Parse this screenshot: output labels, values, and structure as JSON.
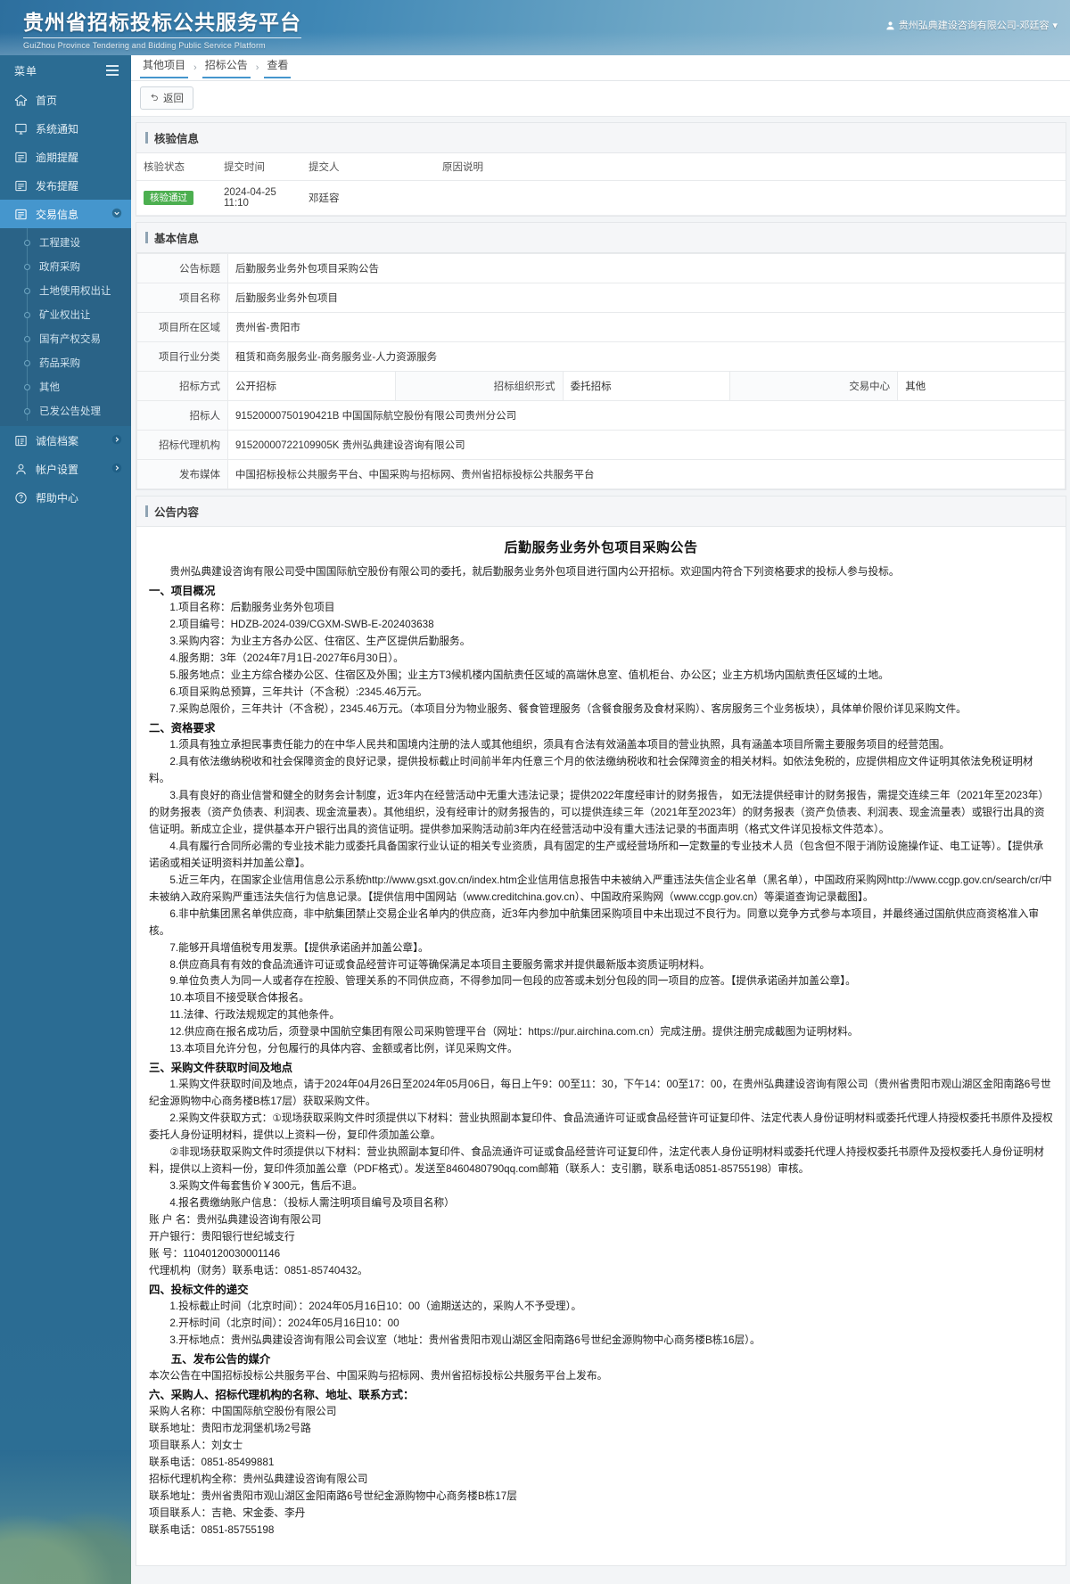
{
  "header": {
    "title": "贵州省招标投标公共服务平台",
    "subtitle": "GuiZhou Province Tendering and Bidding Public Service Platform",
    "user": "贵州弘典建设咨询有限公司-邓廷容",
    "user_caret": "▾"
  },
  "sidebar": {
    "menu_label": "菜单",
    "items": [
      {
        "label": "首页",
        "icon": "home-icon"
      },
      {
        "label": "系统通知",
        "icon": "monitor-icon"
      },
      {
        "label": "逾期提醒",
        "icon": "list-icon"
      },
      {
        "label": "发布提醒",
        "icon": "list-icon"
      },
      {
        "label": "交易信息",
        "icon": "list-icon",
        "active": true,
        "caret": "⌄"
      }
    ],
    "sub_items": [
      {
        "label": "工程建设"
      },
      {
        "label": "政府采购"
      },
      {
        "label": "土地使用权出让"
      },
      {
        "label": "矿业权出让"
      },
      {
        "label": "国有产权交易"
      },
      {
        "label": "药品采购"
      },
      {
        "label": "其他"
      },
      {
        "label": "已发公告处理"
      }
    ],
    "bottom_items": [
      {
        "label": "诚信档案",
        "icon": "archive-icon",
        "caret": "❯"
      },
      {
        "label": "帐户设置",
        "icon": "user-icon",
        "caret": "❯"
      },
      {
        "label": "帮助中心",
        "icon": "help-icon"
      }
    ]
  },
  "breadcrumb": {
    "items": [
      "其他项目",
      "招标公告",
      "查看"
    ],
    "separator": "›"
  },
  "toolbar": {
    "back_label": "返回",
    "back_icon": "undo-icon"
  },
  "verify_panel": {
    "title": "核验信息",
    "columns": [
      "核验状态",
      "提交时间",
      "提交人",
      "原因说明"
    ],
    "rows": [
      {
        "status": "核验通过",
        "time": "2024-04-25 11:10",
        "person": "邓廷容",
        "reason": ""
      }
    ]
  },
  "basic_panel": {
    "title": "基本信息",
    "fields": {
      "notice_title_label": "公告标题",
      "notice_title_value": "后勤服务业务外包项目采购公告",
      "project_name_label": "项目名称",
      "project_name_value": "后勤服务业务外包项目",
      "region_label": "项目所在区域",
      "region_value": "贵州省-贵阳市",
      "industry_label": "项目行业分类",
      "industry_value": "租赁和商务服务业-商务服务业-人力资源服务",
      "bid_method_label": "招标方式",
      "bid_method_value": "公开招标",
      "org_form_label": "招标组织形式",
      "org_form_value": "委托招标",
      "center_label": "交易中心",
      "center_value": "其他",
      "tenderer_label": "招标人",
      "tenderer_value": "91520000750190421B 中国国际航空股份有限公司贵州分公司",
      "agency_label": "招标代理机构",
      "agency_value": "91520000722109905K 贵州弘典建设咨询有限公司",
      "media_label": "发布媒体",
      "media_value": "中国招标投标公共服务平台、中国采购与招标网、贵州省招标投标公共服务平台"
    }
  },
  "content_panel": {
    "title": "公告内容",
    "doc_title": "后勤服务业务外包项目采购公告",
    "intro": "贵州弘典建设咨询有限公司受中国国际航空股份有限公司的委托，就后勤服务业务外包项目进行国内公开招标。欢迎国内符合下列资格要求的投标人参与投标。",
    "sections": [
      {
        "heading": "一、项目概况",
        "paragraphs": [
          "1.项目名称：后勤服务业务外包项目",
          "2.项目编号：HDZB-2024-039/CGXM-SWB-E-202403638",
          "3.采购内容：为业主方各办公区、住宿区、生产区提供后勤服务。",
          "4.服务期：3年（2024年7月1日-2027年6月30日）。",
          "5.服务地点：业主方综合楼办公区、住宿区及外围；业主方T3候机楼内国航责任区域的高端休息室、值机柜台、办公区；业主方机场内国航责任区域的土地。",
          "6.项目采购总预算，三年共计（不含税）:2345.46万元。",
          "7.采购总限价，三年共计（不含税），2345.46万元。（本项目分为物业服务、餐食管理服务（含餐食服务及食材采购）、客房服务三个业务板块），具体单价限价详见采购文件。"
        ]
      },
      {
        "heading": "二、资格要求",
        "paragraphs": [
          "1.须具有独立承担民事责任能力的在中华人民共和国境内注册的法人或其他组织，须具有合法有效涵盖本项目的营业执照，具有涵盖本项目所需主要服务项目的经营范围。",
          "2.具有依法缴纳税收和社会保障资金的良好记录，提供投标截止时间前半年内任意三个月的依法缴纳税收和社会保障资金的相关材料。如依法免税的，应提供相应文件证明其依法免税证明材料。",
          "3.具有良好的商业信誉和健全的财务会计制度，近3年内在经营活动中无重大违法记录；提供2022年度经审计的财务报告， 如无法提供经审计的财务报告，需提交连续三年（2021年至2023年）的财务报表（资产负债表、利润表、现金流量表）。其他组织，没有经审计的财务报告的，可以提供连续三年（2021年至2023年）的财务报表（资产负债表、利润表、现金流量表）或银行出具的资信证明。新成立企业，提供基本开户银行出具的资信证明。提供参加采购活动前3年内在经营活动中没有重大违法记录的书面声明（格式文件详见投标文件范本）。",
          "4.具有履行合同所必需的专业技术能力或委托具备国家行业认证的相关专业资质，具有固定的生产或经营场所和一定数量的专业技术人员（包含但不限于消防设施操作证、电工证等）。【提供承诺函或相关证明资料并加盖公章】。",
          "5.近三年内，在国家企业信用信息公示系统http://www.gsxt.gov.cn/index.htm企业信用信息报告中未被纳入严重违法失信企业名单（黑名单），中国政府采购网http://www.ccgp.gov.cn/search/cr/中未被纳入政府采购严重违法失信行为信息记录。【提供信用中国网站（www.creditchina.gov.cn）、中国政府采购网（www.ccgp.gov.cn）等渠道查询记录截图】。",
          "6.非中航集团黑名单供应商，非中航集团禁止交易企业名单内的供应商，近3年内参加中航集团采购项目中未出现过不良行为。同意以竞争方式参与本项目，并最终通过国航供应商资格准入审核。",
          "7.能够开具增值税专用发票。【提供承诺函并加盖公章】。",
          "8.供应商具有有效的食品流通许可证或食品经营许可证等确保满足本项目主要服务需求并提供最新版本资质证明材料。",
          "9.单位负责人为同一人或者存在控股、管理关系的不同供应商，不得参加同一包段的应答或未划分包段的同一项目的应答。【提供承诺函并加盖公章】。",
          "10.本项目不接受联合体报名。",
          "11.法律、行政法规规定的其他条件。",
          "12.供应商在报名成功后，须登录中国航空集团有限公司采购管理平台（网址：https://pur.airchina.com.cn）完成注册。提供注册完成截图为证明材料。",
          "13.本项目允许分包，分包履行的具体内容、金额或者比例，详见采购文件。"
        ]
      },
      {
        "heading": "三、采购文件获取时间及地点",
        "paragraphs": [
          "1.采购文件获取时间及地点，请于2024年04月26日至2024年05月06日，每日上午9：00至11：30，下午14：00至17：00，在贵州弘典建设咨询有限公司（贵州省贵阳市观山湖区金阳南路6号世纪金源购物中心商务楼B栋17层）获取采购文件。",
          "2.采购文件获取方式：①现场获取采购文件时须提供以下材料：营业执照副本复印件、食品流通许可证或食品经营许可证复印件、法定代表人身份证明材料或委托代理人持授权委托书原件及授权委托人身份证明材料，提供以上资料一份，复印件须加盖公章。",
          "②非现场获取采购文件时须提供以下材料：营业执照副本复印件、食品流通许可证或食品经营许可证复印件，法定代表人身份证明材料或委托代理人持授权委托书原件及授权委托人身份证明材料，提供以上资料一份，复印件须加盖公章（PDF格式）。发送至8460480790qq.com邮箱（联系人：支引鹏，联系电话0851-85755198）审核。",
          "3.采购文件每套售价￥300元，售后不退。",
          "4.报名费缴纳账户信息：（投标人需注明项目编号及项目名称）"
        ],
        "flat_paragraphs": [
          "账  户  名：贵州弘典建设咨询有限公司",
          "开户银行：贵阳银行世纪城支行",
          "账        号：11040120030001146",
          "代理机构（财务）联系电话：0851-85740432。"
        ]
      },
      {
        "heading": "四、投标文件的递交",
        "paragraphs": [
          "1.投标截止时间（北京时间）：2024年05月16日10：00（逾期送达的，采购人不予受理）。",
          "2.开标时间（北京时间）：2024年05月16日10：00",
          "3.开标地点：贵州弘典建设咨询有限公司会议室（地址：贵州省贵阳市观山湖区金阳南路6号世纪金源购物中心商务楼B栋16层）。"
        ]
      },
      {
        "heading": "五、发布公告的媒介",
        "flat_paragraphs": [
          "本次公告在中国招标投标公共服务平台、中国采购与招标网、贵州省招标投标公共服务平台上发布。"
        ]
      },
      {
        "heading": "六、采购人、招标代理机构的名称、地址、联系方式：",
        "flat_paragraphs": [
          "采购人名称：中国国际航空股份有限公司",
          "联系地址：贵阳市龙洞堡机场2号路",
          "项目联系人：刘女士",
          "联系电话：0851-85499881",
          "招标代理机构全称：贵州弘典建设咨询有限公司",
          "联系地址：贵州省贵阳市观山湖区金阳南路6号世纪金源购物中心商务楼B栋17层",
          "项目联系人：吉艳、宋金委、李丹",
          "联系电话：0851-85755198"
        ]
      }
    ]
  }
}
